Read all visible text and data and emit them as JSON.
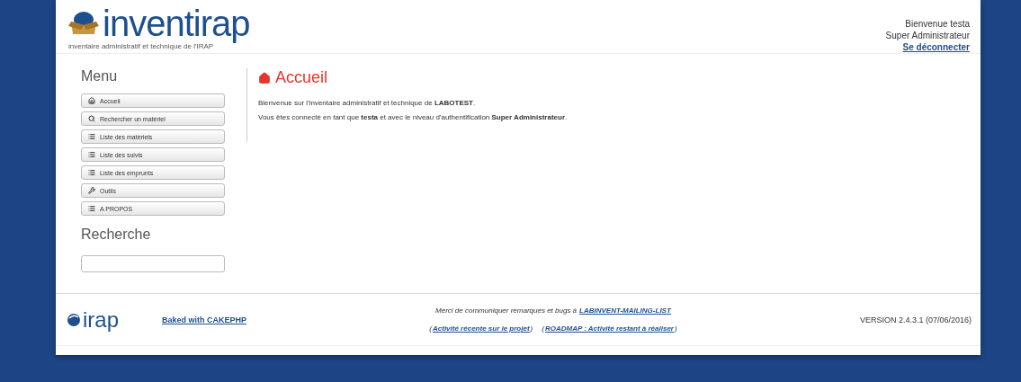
{
  "header": {
    "logo_text": "inventirap",
    "logo_subtitle": "inventaire administratif et technique de l'IRAP",
    "user": {
      "welcome": "Bienvenue testa",
      "role": "Super Administrateur",
      "logout": "Se déconnecter"
    }
  },
  "sidebar": {
    "menu_title": "Menu",
    "items": [
      {
        "label": "Accueil",
        "kind": "home"
      },
      {
        "label": "Rechercher un matériel",
        "kind": "search"
      },
      {
        "label": "Liste des matériels",
        "kind": "list"
      },
      {
        "label": "Liste des suivis",
        "kind": "list"
      },
      {
        "label": "Liste des emprunts",
        "kind": "list"
      },
      {
        "label": "Outils",
        "kind": "tool"
      },
      {
        "label": "A PROPOS",
        "kind": "list"
      }
    ],
    "search_title": "Recherche"
  },
  "main": {
    "title": "Accueil",
    "paragraphs": [
      "Bienvenue sur l'inventaire administratif et technique de **LABOTEST**.",
      "Vous êtes connecté en tant que **testa** et avec le niveau d'authentification **Super Administrateur**."
    ]
  },
  "footer": {
    "logo_text": "irap",
    "cake_link": "Baked with CAKEPHP",
    "message": "Merci de communiquer remarques et bugs à",
    "mailing_link": "LABINVENT-MAILING-LIST",
    "links": [
      {
        "open": "(",
        "label": "Activité récente sur le projet",
        "close": ")"
      },
      {
        "open": "(",
        "label": "ROADMAP : Activité restant à réaliser",
        "close": ")"
      }
    ],
    "version": "VERSION 2.4.3.1 (07/06/2016)"
  }
}
